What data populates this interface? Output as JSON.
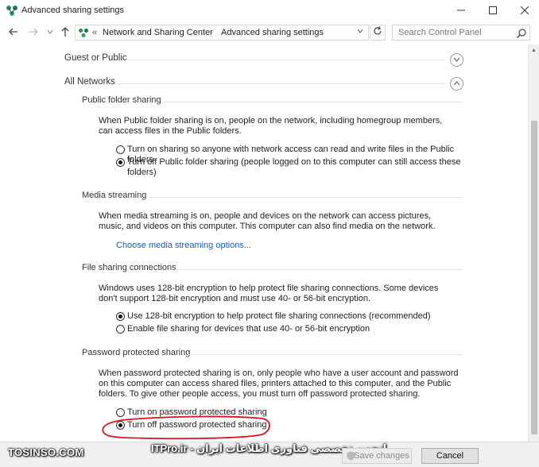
{
  "window": {
    "title": "Advanced sharing settings"
  },
  "address": {
    "crumb1": "Network and Sharing Center",
    "crumb2": "Advanced sharing settings",
    "chevron": "«",
    "separator": "›"
  },
  "search": {
    "placeholder": "Search Control Panel"
  },
  "profiles": {
    "guest_public": "Guest or Public",
    "all_networks": "All Networks"
  },
  "sections": {
    "public_folder": {
      "title": "Public folder sharing",
      "description": "When Public folder sharing is on, people on the network, including homegroup members, can access files in the Public folders.",
      "option1": "Turn on sharing so anyone with network access can read and write files in the Public folders",
      "option2": "Turn off Public folder sharing (people logged on to this computer can still access these folders)"
    },
    "media": {
      "title": "Media streaming",
      "description": "When media streaming is on, people and devices on the network can access pictures, music, and videos on this computer. This computer can also find media on the network.",
      "link": "Choose media streaming options..."
    },
    "file_sharing": {
      "title": "File sharing connections",
      "description": "Windows uses 128-bit encryption to help protect file sharing connections. Some devices don't support 128-bit encryption and must use 40- or 56-bit encryption.",
      "option1": "Use 128-bit encryption to help protect file sharing connections (recommended)",
      "option2": "Enable file sharing for devices that use 40- or 56-bit encryption"
    },
    "password": {
      "title": "Password protected sharing",
      "description": "When password protected sharing is on, only people who have a user account and password on this computer can access shared files, printers attached to this computer, and the Public folders. To give other people access, you must turn off password protected sharing.",
      "option1": "Turn on password protected sharing",
      "option2": "Turn off password protected sharing"
    }
  },
  "buttons": {
    "save": "Save changes",
    "cancel": "Cancel"
  },
  "watermark": {
    "left": "TOSINSO.COM",
    "mid": "ITPro.ir - انجمن تخصصی فناوری اطلاعات ایران"
  },
  "colors": {
    "link": "#1a5fb4",
    "annotation": "#d9141b"
  }
}
